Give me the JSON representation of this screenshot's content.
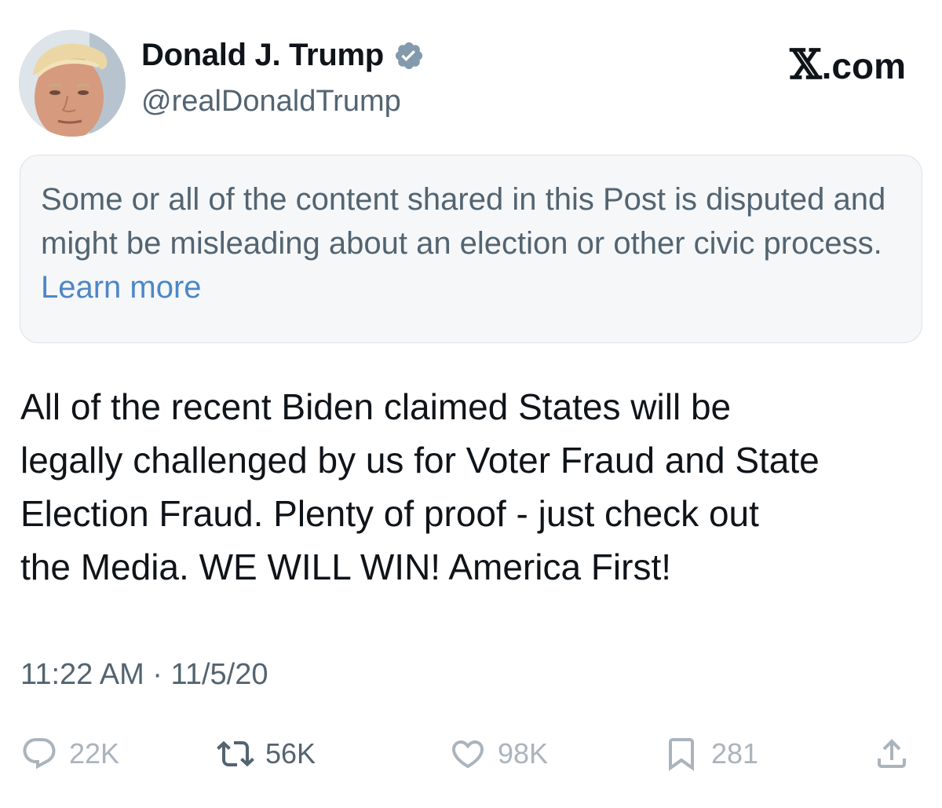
{
  "author": {
    "display_name": "Donald J. Trump",
    "handle": "@realDonaldTrump",
    "verified": true,
    "verified_color": "#829aab"
  },
  "brand": {
    "mark": "𝕏",
    "suffix": ".com"
  },
  "notice": {
    "text": "Some or all of the content shared in this Post is disputed and might be misleading about an election or other civic process.",
    "link_label": "Learn more",
    "link_color": "#4d87c6"
  },
  "post": {
    "lines": [
      "All of the recent Biden claimed States will be",
      "legally challenged by us for Voter Fraud and State",
      "Election Fraud. Plenty of proof - just check out",
      "the Media. WE WILL WIN! America First!"
    ],
    "time": "11:22 AM",
    "separator": "·",
    "date": "11/5/20"
  },
  "actions": {
    "reply": {
      "icon": "reply-icon",
      "count": "22K"
    },
    "repost": {
      "icon": "repost-icon",
      "count": "56K"
    },
    "like": {
      "icon": "heart-icon",
      "count": "98K"
    },
    "bookmark": {
      "icon": "bookmark-icon",
      "count": "281"
    },
    "share": {
      "icon": "share-icon"
    }
  },
  "colors": {
    "text_primary": "#0f1419",
    "text_secondary": "#536471",
    "notice_bg": "#f5f7f9",
    "action_muted": "#aab4bd"
  }
}
